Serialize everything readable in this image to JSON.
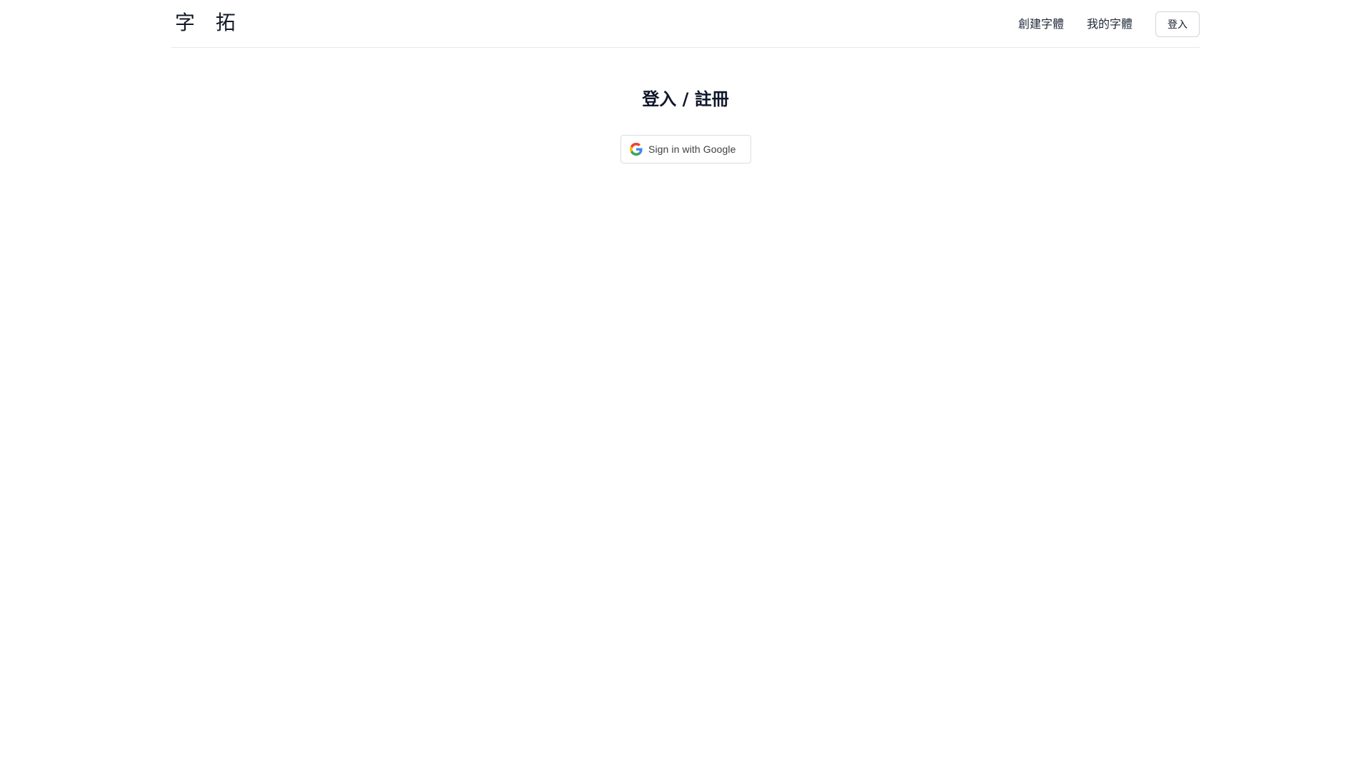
{
  "header": {
    "logo_text": "字 拓",
    "nav": {
      "create_font": "創建字體",
      "my_fonts": "我的字體",
      "login_button": "登入"
    }
  },
  "main": {
    "title": "登入 / 註冊",
    "google_signin_label": "Sign in with Google",
    "google_icon": "google-g-icon"
  },
  "colors": {
    "text_primary": "#111827",
    "border": "#e5e7eb",
    "google_blue": "#4285F4",
    "google_red": "#EA4335",
    "google_yellow": "#FBBC05",
    "google_green": "#34A853"
  }
}
